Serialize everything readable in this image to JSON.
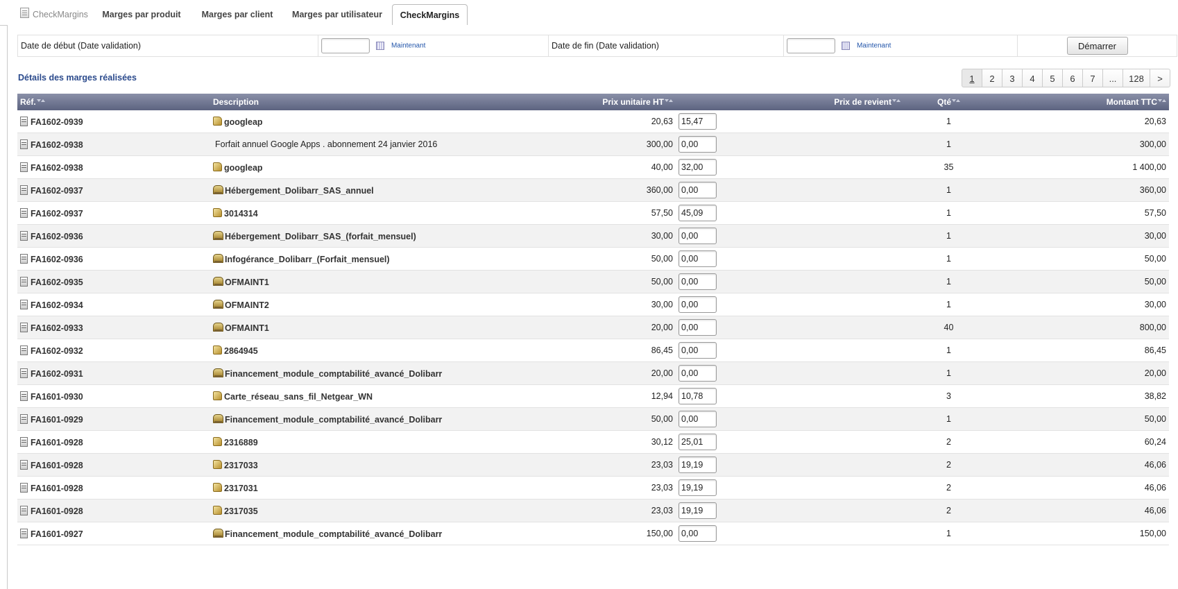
{
  "tabs": [
    {
      "label": "CheckMargins",
      "icon": "document-icon"
    },
    {
      "label": "Marges par produit"
    },
    {
      "label": "Marges par client"
    },
    {
      "label": "Marges par utilisateur"
    },
    {
      "label": "CheckMargins",
      "active": true
    }
  ],
  "filters": {
    "start_label": "Date de début (Date validation)",
    "start_value": "",
    "start_now": "Maintenant",
    "end_label": "Date de fin (Date validation)",
    "end_value": "",
    "end_now": "Maintenant",
    "start_button": "Démarrer"
  },
  "section_title": "Détails des marges réalisées",
  "pagination": [
    "1",
    "2",
    "3",
    "4",
    "5",
    "6",
    "7",
    "...",
    "128",
    ">"
  ],
  "pagination_current": "1",
  "table": {
    "headers": {
      "ref": "Réf.",
      "description": "Description",
      "unit_price": "Prix unitaire HT",
      "cost_price": "Prix de revient",
      "qty": "Qté",
      "amount": "Montant TTC"
    },
    "rows": [
      {
        "ref": "FA1602-0939",
        "icon": "product-icon",
        "desc": "googleap",
        "bold": true,
        "price": "20,63",
        "cost": "15,47",
        "qty": "1",
        "amount": "20,63"
      },
      {
        "ref": "FA1602-0938",
        "icon": "",
        "desc": "Forfait annuel Google Apps . abonnement 24 janvier 2016",
        "bold": false,
        "price": "300,00",
        "cost": "0,00",
        "qty": "1",
        "amount": "300,00"
      },
      {
        "ref": "FA1602-0938",
        "icon": "product-icon",
        "desc": "googleap",
        "bold": true,
        "price": "40,00",
        "cost": "32,00",
        "qty": "35",
        "amount": "1 400,00"
      },
      {
        "ref": "FA1602-0937",
        "icon": "service-icon",
        "desc": "Hébergement_Dolibarr_SAS_annuel",
        "bold": true,
        "price": "360,00",
        "cost": "0,00",
        "qty": "1",
        "amount": "360,00"
      },
      {
        "ref": "FA1602-0937",
        "icon": "product-icon",
        "desc": "3014314",
        "bold": true,
        "price": "57,50",
        "cost": "45,09",
        "qty": "1",
        "amount": "57,50"
      },
      {
        "ref": "FA1602-0936",
        "icon": "service-icon",
        "desc": "Hébergement_Dolibarr_SAS_(forfait_mensuel)",
        "bold": true,
        "price": "30,00",
        "cost": "0,00",
        "qty": "1",
        "amount": "30,00"
      },
      {
        "ref": "FA1602-0936",
        "icon": "service-icon",
        "desc": "Infogérance_Dolibarr_(Forfait_mensuel)",
        "bold": true,
        "price": "50,00",
        "cost": "0,00",
        "qty": "1",
        "amount": "50,00"
      },
      {
        "ref": "FA1602-0935",
        "icon": "service-icon",
        "desc": "OFMAINT1",
        "bold": true,
        "price": "50,00",
        "cost": "0,00",
        "qty": "1",
        "amount": "50,00"
      },
      {
        "ref": "FA1602-0934",
        "icon": "service-icon",
        "desc": "OFMAINT2",
        "bold": true,
        "price": "30,00",
        "cost": "0,00",
        "qty": "1",
        "amount": "30,00"
      },
      {
        "ref": "FA1602-0933",
        "icon": "service-icon",
        "desc": "OFMAINT1",
        "bold": true,
        "price": "20,00",
        "cost": "0,00",
        "qty": "40",
        "amount": "800,00"
      },
      {
        "ref": "FA1602-0932",
        "icon": "product-icon",
        "desc": "2864945",
        "bold": true,
        "price": "86,45",
        "cost": "0,00",
        "qty": "1",
        "amount": "86,45"
      },
      {
        "ref": "FA1602-0931",
        "icon": "service-icon",
        "desc": "Financement_module_comptabilité_avancé_Dolibarr",
        "bold": true,
        "price": "20,00",
        "cost": "0,00",
        "qty": "1",
        "amount": "20,00"
      },
      {
        "ref": "FA1601-0930",
        "icon": "product-icon",
        "desc": "Carte_réseau_sans_fil_Netgear_WN",
        "bold": true,
        "price": "12,94",
        "cost": "10,78",
        "qty": "3",
        "amount": "38,82"
      },
      {
        "ref": "FA1601-0929",
        "icon": "service-icon",
        "desc": "Financement_module_comptabilité_avancé_Dolibarr",
        "bold": true,
        "price": "50,00",
        "cost": "0,00",
        "qty": "1",
        "amount": "50,00"
      },
      {
        "ref": "FA1601-0928",
        "icon": "product-icon",
        "desc": "2316889",
        "bold": true,
        "price": "30,12",
        "cost": "25,01",
        "qty": "2",
        "amount": "60,24"
      },
      {
        "ref": "FA1601-0928",
        "icon": "product-icon",
        "desc": "2317033",
        "bold": true,
        "price": "23,03",
        "cost": "19,19",
        "qty": "2",
        "amount": "46,06"
      },
      {
        "ref": "FA1601-0928",
        "icon": "product-icon",
        "desc": "2317031",
        "bold": true,
        "price": "23,03",
        "cost": "19,19",
        "qty": "2",
        "amount": "46,06"
      },
      {
        "ref": "FA1601-0928",
        "icon": "product-icon",
        "desc": "2317035",
        "bold": true,
        "price": "23,03",
        "cost": "19,19",
        "qty": "2",
        "amount": "46,06"
      },
      {
        "ref": "FA1601-0927",
        "icon": "service-icon",
        "desc": "Financement_module_comptabilité_avancé_Dolibarr",
        "bold": true,
        "price": "150,00",
        "cost": "0,00",
        "qty": "1",
        "amount": "150,00"
      }
    ]
  },
  "colors": {
    "header_bg": "#5c6380",
    "section_title": "#2b4a8c",
    "link": "#2255aa"
  }
}
